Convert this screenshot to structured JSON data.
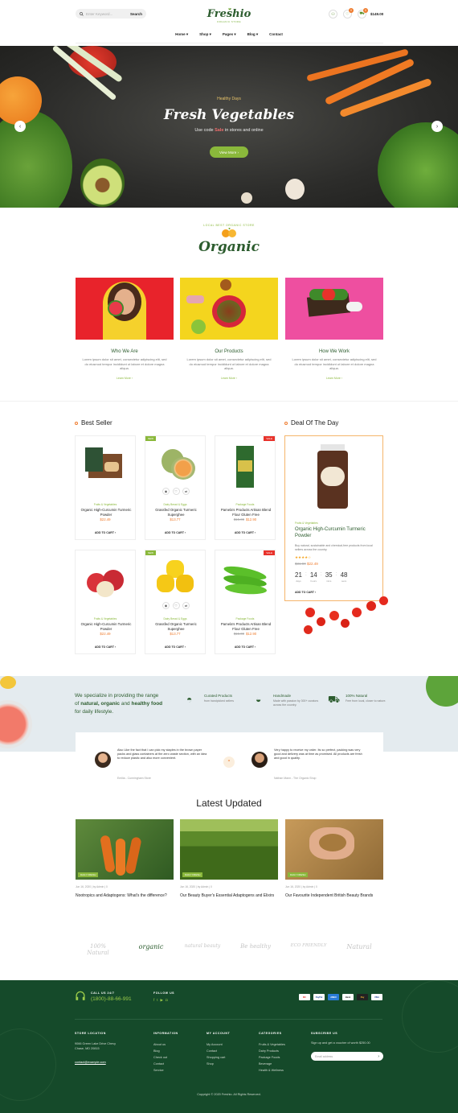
{
  "header": {
    "search_placeholder": "Enter Keyword...",
    "search_button": "Search",
    "logo": "Freshio",
    "logo_tag": "ORGANIC STORE",
    "wishlist_count": "0",
    "cart_count": "0",
    "cart_total": "$149.00"
  },
  "nav": [
    {
      "label": "Home ▾"
    },
    {
      "label": "Shop ▾"
    },
    {
      "label": "Pages ▾"
    },
    {
      "label": "Blog ▾"
    },
    {
      "label": "Contact"
    }
  ],
  "hero": {
    "subtitle": "Healthy Days",
    "title": "Fresh Vegetables",
    "code_pre": "Use code",
    "code": "Sale",
    "code_post": "in stores and online",
    "button": "View More ›"
  },
  "organic": {
    "small": "LOCAL BEST ORGANIC STORE",
    "big": "Organic"
  },
  "about": [
    {
      "title": "Who We Are",
      "text": "Lorem ipsum dolor sit amet, consectetur adipiscing elit, sed do eiusmod tempor incididunt ut labore et dolore magna aliqua.",
      "link": "Learn More ›"
    },
    {
      "title": "Our Products",
      "text": "Lorem ipsum dolor sit amet, consectetur adipiscing elit, sed do eiusmod tempor incididunt ut labore et dolore magna aliqua.",
      "link": "Learn More ›"
    },
    {
      "title": "How We Work",
      "text": "Lorem ipsum dolor sit amet, consectetur adipiscing elit, sed do eiusmod tempor incididunt ut labore et dolore magna aliqua.",
      "link": "Learn More ›"
    }
  ],
  "best_seller": {
    "title": "Best Seller",
    "products": [
      {
        "cat": "Fruits & Vegetables",
        "name": "Organic High-Curcumin Turmeric Powder",
        "old": "",
        "price": "$22.49",
        "cart": "ADD TO CART ›",
        "tag": ""
      },
      {
        "cat": "Dairy Bread & Eggs",
        "name": "Grassfed Organic Turmeric Superghee",
        "old": "",
        "price": "$13.77",
        "cart": "ADD TO CART ›",
        "tag": "NEW"
      },
      {
        "cat": "Package Foods",
        "name": "Pamela's Products Artisan Blend Flour Gluten Free",
        "old": "$15.00",
        "price": "$12.90",
        "cart": "ADD TO CART ›",
        "tag": "SALE"
      },
      {
        "cat": "Fruits & Vegetables",
        "name": "Organic High-Curcumin Turmeric Powder",
        "old": "",
        "price": "$22.49",
        "cart": "ADD TO CART ›",
        "tag": ""
      },
      {
        "cat": "Dairy Bread & Eggs",
        "name": "Grassfed Organic Turmeric Superghee",
        "old": "",
        "price": "$13.77",
        "cart": "ADD TO CART ›",
        "tag": "NEW"
      },
      {
        "cat": "Package Foods",
        "name": "Pamela's Products Artisan Blend Flour Gluten Free",
        "old": "$15.00",
        "price": "$12.90",
        "cart": "ADD TO CART ›",
        "tag": "SALE"
      }
    ]
  },
  "deal": {
    "title": "Deal Of The Day",
    "cat": "Fruits & Vegetables",
    "name": "Organic High-Curcumin Turmeric Powder",
    "desc": "Buy natural, sustainable and chemical-free products from local sellers across the country.",
    "rating": "★★★★☆",
    "old": "$31.90",
    "price": "$22.49",
    "days": "21",
    "hours": "14",
    "mins": "35",
    "secs": "48",
    "l_days": "days",
    "l_hours": "hours",
    "l_mins": "mins",
    "l_secs": "secs",
    "cart": "ADD TO CART ›"
  },
  "banner": {
    "line1": "We specialize in providing the range",
    "line2a": "of",
    "natural": "natural,",
    "organic": "organic",
    "and": "and",
    "healthy": "healthy food",
    "line3": "for daily lifestyle.",
    "features": [
      {
        "title": "Curated Products",
        "desc": "from handpicked sellers"
      },
      {
        "title": "Handmade",
        "desc": "Made with passion by 300+ curators across the country."
      },
      {
        "title": "100% Natural",
        "desc": "Free from local, closer to nature."
      }
    ]
  },
  "testimonials": [
    {
      "quote": "Also Like the fact that I can pick my staples in the brown paper packs and glass containers at the zero waste section, with an idea to reduce plastic and also more convenient.",
      "author": "Emilia - Cunningham Store"
    },
    {
      "quote": "Very happy to receive my order. Its so perfect, packing was very good and delivery was at time as promised. All products are fresh and good in quality.",
      "author": "Nathan Mann - The Organic Shop"
    }
  ],
  "blog": {
    "title": "Latest Updated",
    "posts": [
      {
        "tag": "DAILY FRESH",
        "meta": "Jun 16, 2020 | by Admin | 0",
        "title": "Nootropics and Adaptogens: What's the difference?"
      },
      {
        "tag": "DAILY FRESH",
        "meta": "Jun 16, 2020 | by Admin | 0",
        "title": "Our Beauty Buyer's Essential Adaptogens and Elixirs"
      },
      {
        "tag": "DAILY FRESH",
        "meta": "Jun 16, 2020 | by Admin | 0",
        "title": "Our Favourite Independent British Beauty Brands"
      }
    ]
  },
  "brands": [
    "100% Natural",
    "organic",
    "natural beauty",
    "Be healthy",
    "ECO FRIENDLY",
    "Natural"
  ],
  "footer": {
    "call_label": "CALL US 24/7",
    "phone": "(1800)-88-66-991",
    "follow": "FOLLOW US",
    "payments": [
      "MC",
      "PayPal",
      "AMEX",
      "Bank",
      "Pay",
      "VISA"
    ],
    "store_h": "STORE LOCATION",
    "store_addr1": "9066 Green Lake Drive Chevy",
    "store_addr2": "Chase, MD 20815",
    "email": "contact@example.com",
    "info_h": "INFORMATION",
    "info": [
      "About us",
      "Blog",
      "Check out",
      "Contact",
      "Service"
    ],
    "acc_h": "MY ACCOUNT",
    "acc": [
      "My Account",
      "Contact",
      "Shopping cart",
      "Shop"
    ],
    "cat_h": "CATEGORIES",
    "cats": [
      "Fruits & Vegetables",
      "Dairy Products",
      "Package Foods",
      "Beverage",
      "Health & Wellness"
    ],
    "sub_h": "SUBSCRIBE US",
    "sub_text": "Sign up and get a voucher of worth $250.00",
    "sub_placeholder": "Email address",
    "copyright": "Copyright © 2020 Freshio. All Rights Reserved."
  },
  "colors": {
    "green": "#154a2a",
    "accent": "#8ab83b",
    "orange": "#ef7b2d"
  }
}
